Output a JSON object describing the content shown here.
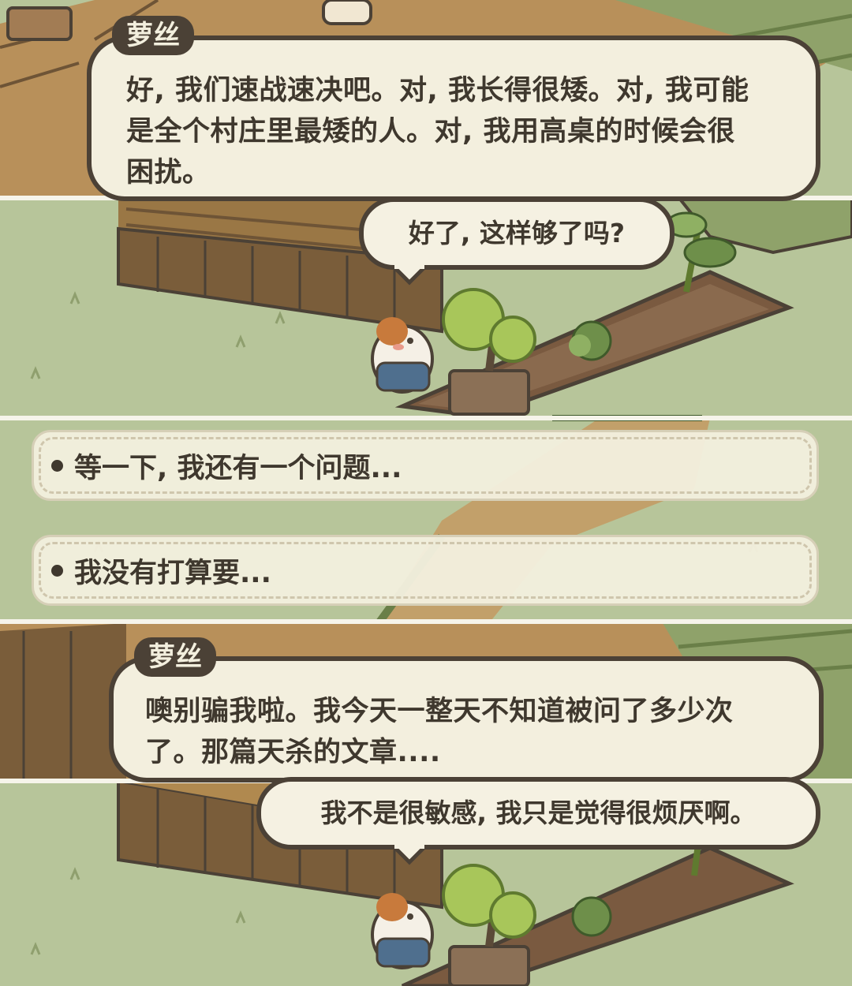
{
  "dialogue_1": {
    "speaker": "萝丝",
    "text_lines": [
      "好, 我们速战速决吧。对, 我长得很矮。对, 我可能",
      "是全个村庄里最矮的人。对, 我用高桌的时候会很",
      "困扰。"
    ]
  },
  "reply_1": {
    "text": "好了, 这样够了吗?"
  },
  "choices": [
    {
      "label": "等一下, 我还有一个问题..."
    },
    {
      "label": "我没有打算要..."
    }
  ],
  "dialogue_2": {
    "speaker": "萝丝",
    "text_lines": [
      "噢别骗我啦。我今天一整天不知道被问了多少次",
      "了。那篇天杀的文章...."
    ]
  },
  "reply_2": {
    "text": "我不是很敏感, 我只是觉得很烦厌啊。"
  },
  "scene": {
    "character": "guinea-pig-gardener",
    "colors": {
      "grass": "#b7c59a",
      "wood": "#a67d48",
      "outline": "#4b4136",
      "bubble": "#f3efde",
      "soil": "#7a5a40",
      "leaf": "#a8c65a"
    }
  }
}
